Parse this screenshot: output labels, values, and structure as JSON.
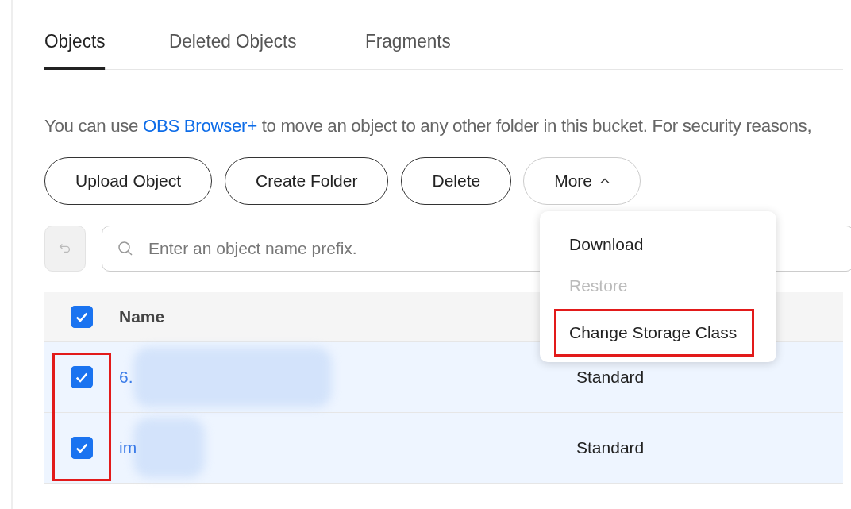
{
  "tabs": [
    {
      "label": "Objects",
      "selected": true
    },
    {
      "label": "Deleted Objects",
      "selected": false
    },
    {
      "label": "Fragments",
      "selected": false
    }
  ],
  "notice": {
    "before": "You can use ",
    "link": "OBS Browser+",
    "after": " to move an object to any other folder in this bucket. For security reasons,"
  },
  "buttons": [
    {
      "label": "Upload Object",
      "kind": "plain"
    },
    {
      "label": "Create Folder",
      "kind": "plain"
    },
    {
      "label": "Delete",
      "kind": "plain"
    },
    {
      "label": "More",
      "kind": "dropdown",
      "expanded": true
    }
  ],
  "search": {
    "placeholder": "Enter an object name prefix."
  },
  "menu": [
    {
      "label": "Download",
      "disabled": false,
      "highlighted": false
    },
    {
      "label": "Restore",
      "disabled": true,
      "highlighted": false
    },
    {
      "label": "Change Storage Class",
      "disabled": false,
      "highlighted": true
    }
  ],
  "table": {
    "header_checked": true,
    "columns": [
      "Name"
    ],
    "checkbox_column_highlighted": true,
    "rows": [
      {
        "name": "6.",
        "storage_class": "Standard",
        "checked": true,
        "selected": true
      },
      {
        "name": "im",
        "storage_class": "Standard",
        "checked": true,
        "selected": true
      }
    ]
  }
}
